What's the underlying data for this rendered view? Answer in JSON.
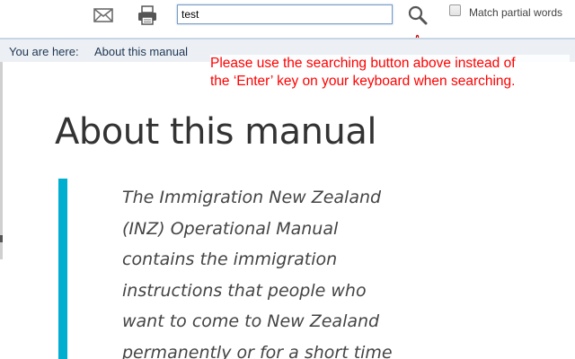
{
  "toolbar": {
    "email_icon": "envelope-icon",
    "print_icon": "printer-icon",
    "search_value": "test",
    "search_button_icon": "magnifier-icon",
    "match_partial_label": "Match partial words",
    "match_partial_checked": false,
    "cursor_icon": "hand-pointer-icon"
  },
  "breadcrumb": {
    "prefix": "You are here:",
    "current": "About this manual"
  },
  "notice": {
    "color": "#ff0000",
    "lines": [
      "Please use the searching button above instead of",
      "the ‘Enter’ key on your keyboard when searching."
    ]
  },
  "content": {
    "title": "About this manual",
    "accent_color": "#00aecf",
    "intro_lines": [
      "The Immigration New Zealand",
      "(INZ) Operational Manual",
      "contains the immigration",
      "instructions that people who",
      "want to come to New Zealand",
      "permanently or for a short time"
    ]
  }
}
